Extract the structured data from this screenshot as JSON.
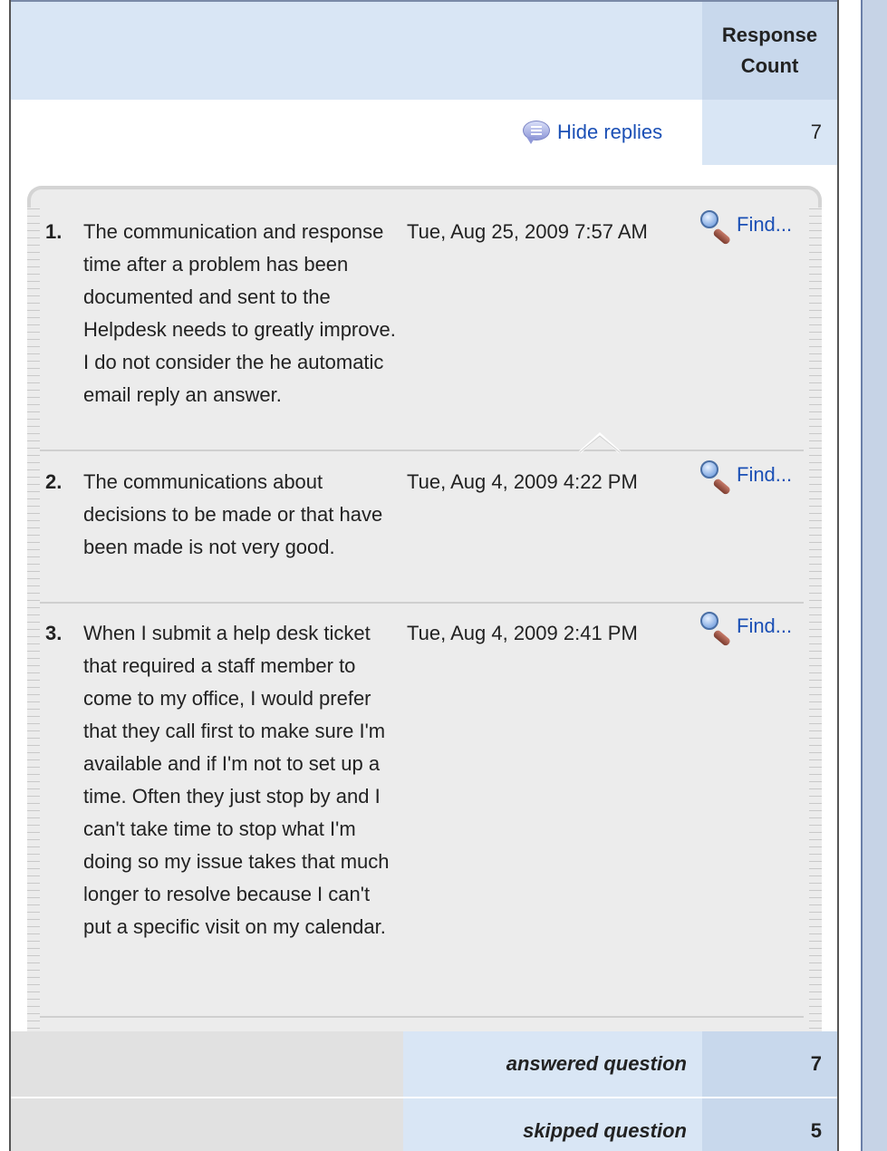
{
  "header": {
    "response_count_label": "Response Count"
  },
  "replies": {
    "toggle_label": "Hide replies",
    "count": "7"
  },
  "responses": [
    {
      "number": "1.",
      "text": "The communication and response time after a problem has been documented and sent to the Helpdesk needs to greatly improve. I do not consider the he automatic email reply an answer.",
      "date": "Tue, Aug 25, 2009 7:57 AM",
      "find_label": "Find..."
    },
    {
      "number": "2.",
      "text": "The communications about decisions to be made or that have been made is not very good.",
      "date": "Tue, Aug 4, 2009 4:22 PM",
      "find_label": "Find..."
    },
    {
      "number": "3.",
      "text": "When I submit a help desk ticket that required a staff member to come to my office, I would prefer that they call first to make sure I'm available and if I'm not to set up a time. Often they just stop by and I can't take time to stop what I'm doing so my issue takes that much longer to resolve because I can't put a specific visit on my calendar.",
      "date": "Tue, Aug 4, 2009 2:41 PM",
      "find_label": "Find..."
    }
  ],
  "summary": {
    "answered_label": "answered question",
    "answered_value": "7",
    "skipped_label": "skipped question",
    "skipped_value": "5"
  },
  "icons": {
    "replies": "speech-bubble-icon",
    "find": "magnifier-icon"
  },
  "colors": {
    "link": "#1a4fb5",
    "header_bg": "#d9e6f5",
    "count_bg": "#c8d8ec",
    "reply_bg": "#ececec"
  }
}
